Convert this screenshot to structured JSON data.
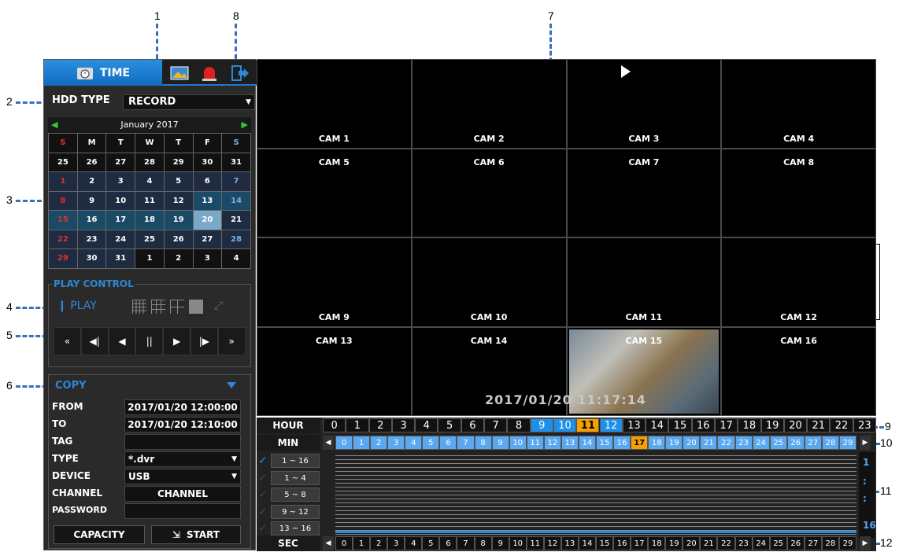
{
  "callouts": [
    "1",
    "2",
    "3",
    "4",
    "5",
    "6",
    "7",
    "8",
    "9",
    "10",
    "11",
    "12"
  ],
  "tabs": {
    "time_label": "TIME",
    "icons": [
      "clock-icon",
      "image-icon",
      "alarm-icon",
      "exit-icon"
    ]
  },
  "hdd": {
    "label": "HDD TYPE",
    "value": "RECORD"
  },
  "calendar": {
    "month": "January",
    "year": "2017",
    "days_header": [
      "S",
      "M",
      "T",
      "W",
      "T",
      "F",
      "S"
    ],
    "weeks": [
      [
        "25",
        "26",
        "27",
        "28",
        "29",
        "30",
        "31"
      ],
      [
        "1",
        "2",
        "3",
        "4",
        "5",
        "6",
        "7"
      ],
      [
        "8",
        "9",
        "10",
        "11",
        "12",
        "13",
        "14"
      ],
      [
        "15",
        "16",
        "17",
        "18",
        "19",
        "20",
        "21"
      ],
      [
        "22",
        "23",
        "24",
        "25",
        "26",
        "27",
        "28"
      ],
      [
        "29",
        "30",
        "31",
        "1",
        "2",
        "3",
        "4"
      ]
    ]
  },
  "play_control": {
    "title": "PLAY CONTROL",
    "play_label": "PLAY",
    "buttons": [
      "«",
      "◀|",
      "◀",
      "||",
      "▶",
      "|▶",
      "»"
    ]
  },
  "copy": {
    "title": "COPY",
    "rows": [
      {
        "label": "FROM",
        "value": "2017/01/20 12:00:00"
      },
      {
        "label": "TO",
        "value": "2017/01/20 12:10:00"
      },
      {
        "label": "TAG",
        "value": ""
      },
      {
        "label": "TYPE",
        "value": "*.dvr"
      },
      {
        "label": "DEVICE",
        "value": "USB"
      },
      {
        "label": "CHANNEL",
        "value": "CHANNEL"
      },
      {
        "label": "PASSWORD",
        "value": ""
      }
    ],
    "capacity_label": "CAPACITY",
    "start_label": "START"
  },
  "cameras": [
    "CAM 1",
    "CAM 2",
    "CAM 3",
    "CAM 4",
    "CAM 5",
    "CAM 6",
    "CAM 7",
    "CAM 8",
    "CAM 9",
    "CAM 10",
    "CAM 11",
    "CAM 12",
    "CAM 13",
    "CAM 14",
    "CAM 15",
    "CAM 16"
  ],
  "osd_time": "2017/01/20 11:17:14",
  "timeline": {
    "hour_label": "HOUR",
    "min_label": "MIN",
    "sec_label": "SEC",
    "hours": [
      "0",
      "1",
      "2",
      "3",
      "4",
      "5",
      "6",
      "7",
      "8",
      "9",
      "10",
      "11",
      "12",
      "13",
      "14",
      "15",
      "16",
      "17",
      "18",
      "19",
      "20",
      "21",
      "22",
      "23"
    ],
    "minutes": [
      "0",
      "1",
      "2",
      "3",
      "4",
      "5",
      "6",
      "7",
      "8",
      "9",
      "10",
      "11",
      "12",
      "13",
      "14",
      "15",
      "16",
      "17",
      "18",
      "19",
      "20",
      "21",
      "22",
      "23",
      "24",
      "25",
      "26",
      "27",
      "28",
      "29"
    ],
    "seconds": [
      "0",
      "1",
      "2",
      "3",
      "4",
      "5",
      "6",
      "7",
      "8",
      "9",
      "10",
      "11",
      "12",
      "13",
      "14",
      "15",
      "16",
      "17",
      "18",
      "19",
      "20",
      "21",
      "22",
      "23",
      "24",
      "25",
      "26",
      "27",
      "28",
      "29"
    ],
    "channel_groups": [
      "1 ~ 16",
      "1 ~ 4",
      "5 ~ 8",
      "9 ~ 12",
      "13 ~ 16"
    ],
    "page_indicator": [
      "1",
      ":",
      ":",
      "16"
    ]
  },
  "colors": {
    "accent": "#1e90e8",
    "current": "#f5a000",
    "callout_line": "#3a6fb8"
  }
}
